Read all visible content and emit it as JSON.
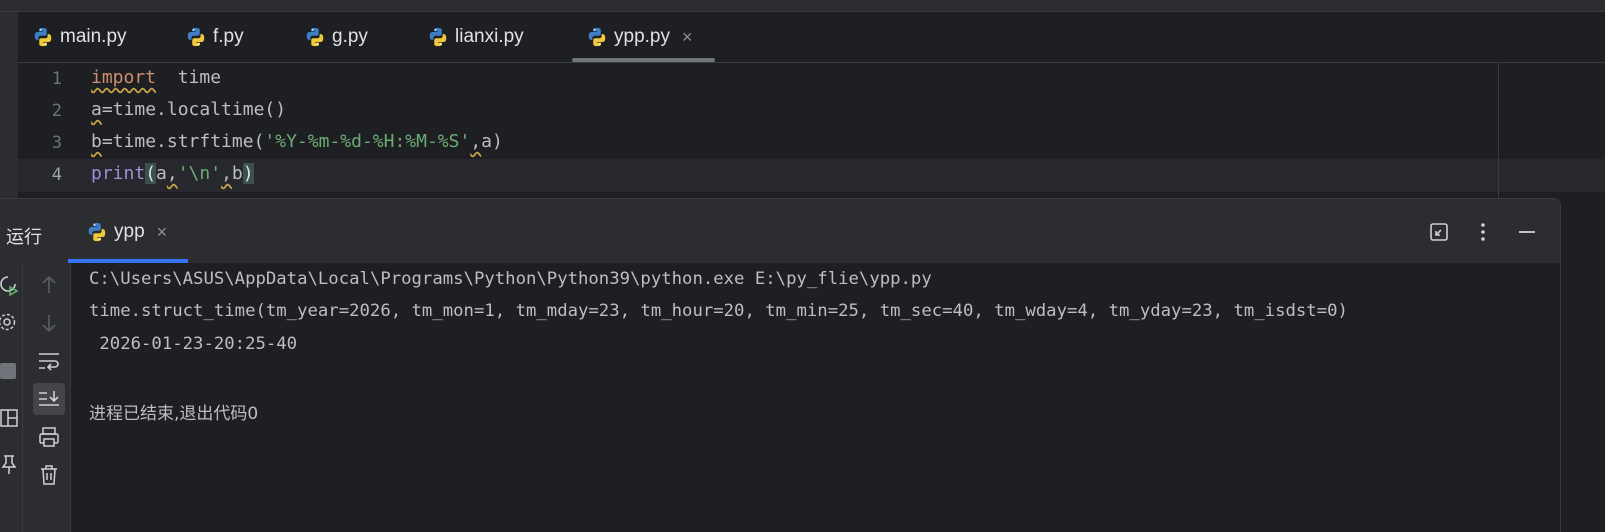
{
  "editor_tabs": [
    {
      "label": "main.py",
      "active": false
    },
    {
      "label": "f.py",
      "active": false
    },
    {
      "label": "g.py",
      "active": false
    },
    {
      "label": "lianxi.py",
      "active": false
    },
    {
      "label": "ypp.py",
      "active": true
    }
  ],
  "tab_close_glyph": "×",
  "editor": {
    "line_numbers": [
      "1",
      "2",
      "3",
      "4"
    ],
    "current_line": 4,
    "line1": {
      "kw": "import",
      "rest": "time"
    },
    "line2": {
      "a": "a",
      "eq": "=",
      "rest": "time.localtime()"
    },
    "line3": {
      "b": "b",
      "eq": "=",
      "call": "time.strftime(",
      "str": "'%Y-%m-%d-%H:%M-%S'",
      "comma": ",",
      "rest": "a)"
    },
    "line4": {
      "fn": "print",
      "lparen": "(",
      "a": "a",
      "comma1": ",",
      "str": "'\\n'",
      "comma2": ",",
      "b": "b",
      "rparen": ")"
    }
  },
  "run_panel": {
    "title": "运行",
    "tab_label": "ypp",
    "header_icons": [
      "restore-icon",
      "more-icon",
      "minimize-icon"
    ],
    "console_lines": [
      "C:\\Users\\ASUS\\AppData\\Local\\Programs\\Python\\Python39\\python.exe E:\\py_flie\\ypp.py",
      "time.struct_time(tm_year=2026, tm_mon=1, tm_mday=23, tm_hour=20, tm_min=25, tm_sec=40, tm_wday=4, tm_yday=23, tm_isdst=0)",
      " 2026-01-23-20:25-40",
      "",
      "进程已结束,退出代码0"
    ]
  },
  "colors": {
    "background": "#1e1f22",
    "panel": "#2b2d30",
    "keyword": "#cf8e6d",
    "function": "#a38bd6",
    "string": "#6aab73",
    "accent": "#3574f0"
  }
}
